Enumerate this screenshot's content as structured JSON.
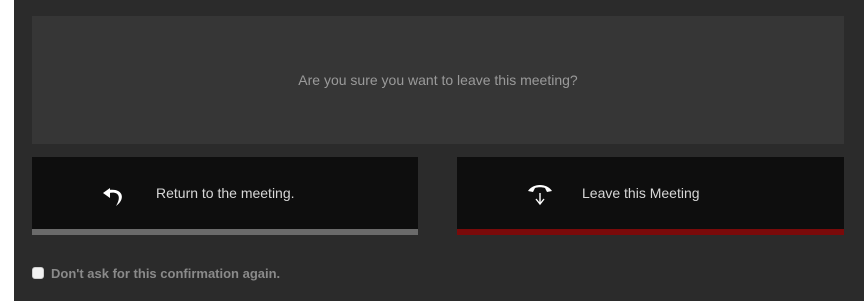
{
  "dialog": {
    "message": "Are you sure you want to leave this meeting?",
    "return_button": {
      "label": "Return to the meeting.",
      "icon": "return-arrow-icon"
    },
    "leave_button": {
      "label": "Leave this Meeting",
      "icon": "hang-up-phone-icon"
    },
    "confirmation": {
      "label": "Don't ask for this confirmation again.",
      "checked": false
    }
  },
  "colors": {
    "dialog_background": "#2b2b2b",
    "panel_background": "#363636",
    "button_background": "#0e0e0e",
    "return_accent": "#6a6a6a",
    "leave_accent": "#7a0a0a"
  }
}
